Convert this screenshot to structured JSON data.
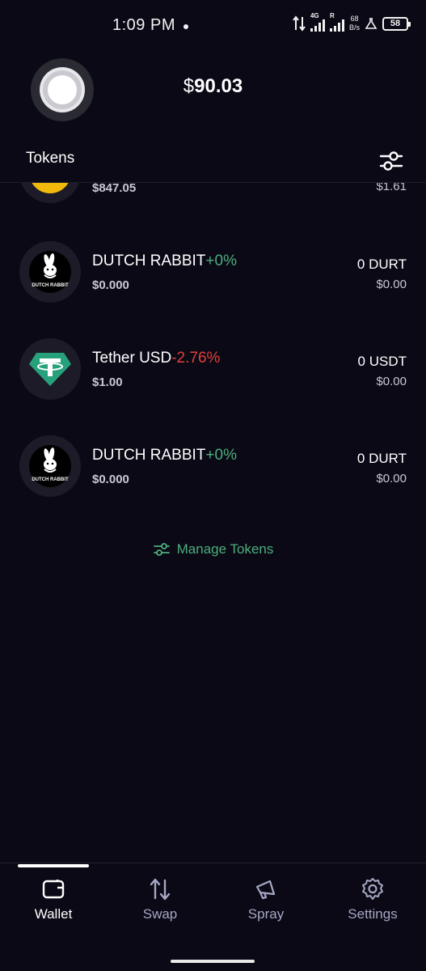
{
  "status_bar": {
    "time": "1:09 PM",
    "network_1": "4G",
    "network_2": "R",
    "speed_value": "68",
    "speed_unit": "B/s",
    "battery": "58"
  },
  "header": {
    "balance_currency": "$",
    "balance_amount": "90.03",
    "section_title": "Tokens"
  },
  "tokens": [
    {
      "name": "",
      "change": "",
      "price": "$847.05",
      "balance": "",
      "value": "$1.61",
      "logo": "bnb-icon"
    },
    {
      "name": "DUTCH RABBIT",
      "change": "+0%",
      "price": "$0.000",
      "balance": "0 DURT",
      "value": "$0.00",
      "logo": "dutch-rabbit-logo",
      "logo_text": "DUTCH RABBIT"
    },
    {
      "name": "Tether USD",
      "change": "-2.76%",
      "price": "$1.00",
      "balance": "0 USDT",
      "value": "$0.00",
      "logo": "tether-icon"
    },
    {
      "name": "DUTCH RABBIT",
      "change": "+0%",
      "price": "$0.000",
      "balance": "0 DURT",
      "value": "$0.00",
      "logo": "dutch-rabbit-logo",
      "logo_text": "DUTCH RABBIT"
    }
  ],
  "manage_tokens_label": "Manage Tokens",
  "bottom_nav": [
    {
      "label": "Wallet",
      "icon": "wallet-icon",
      "active": true
    },
    {
      "label": "Swap",
      "icon": "swap-icon",
      "active": false
    },
    {
      "label": "Spray",
      "icon": "megaphone-icon",
      "active": false
    },
    {
      "label": "Settings",
      "icon": "gear-icon",
      "active": false
    }
  ],
  "colors": {
    "background": "#0a0915",
    "positive": "#4caf7d",
    "negative": "#e0413a",
    "tether": "#26a17b",
    "bnb": "#f0b90b"
  }
}
